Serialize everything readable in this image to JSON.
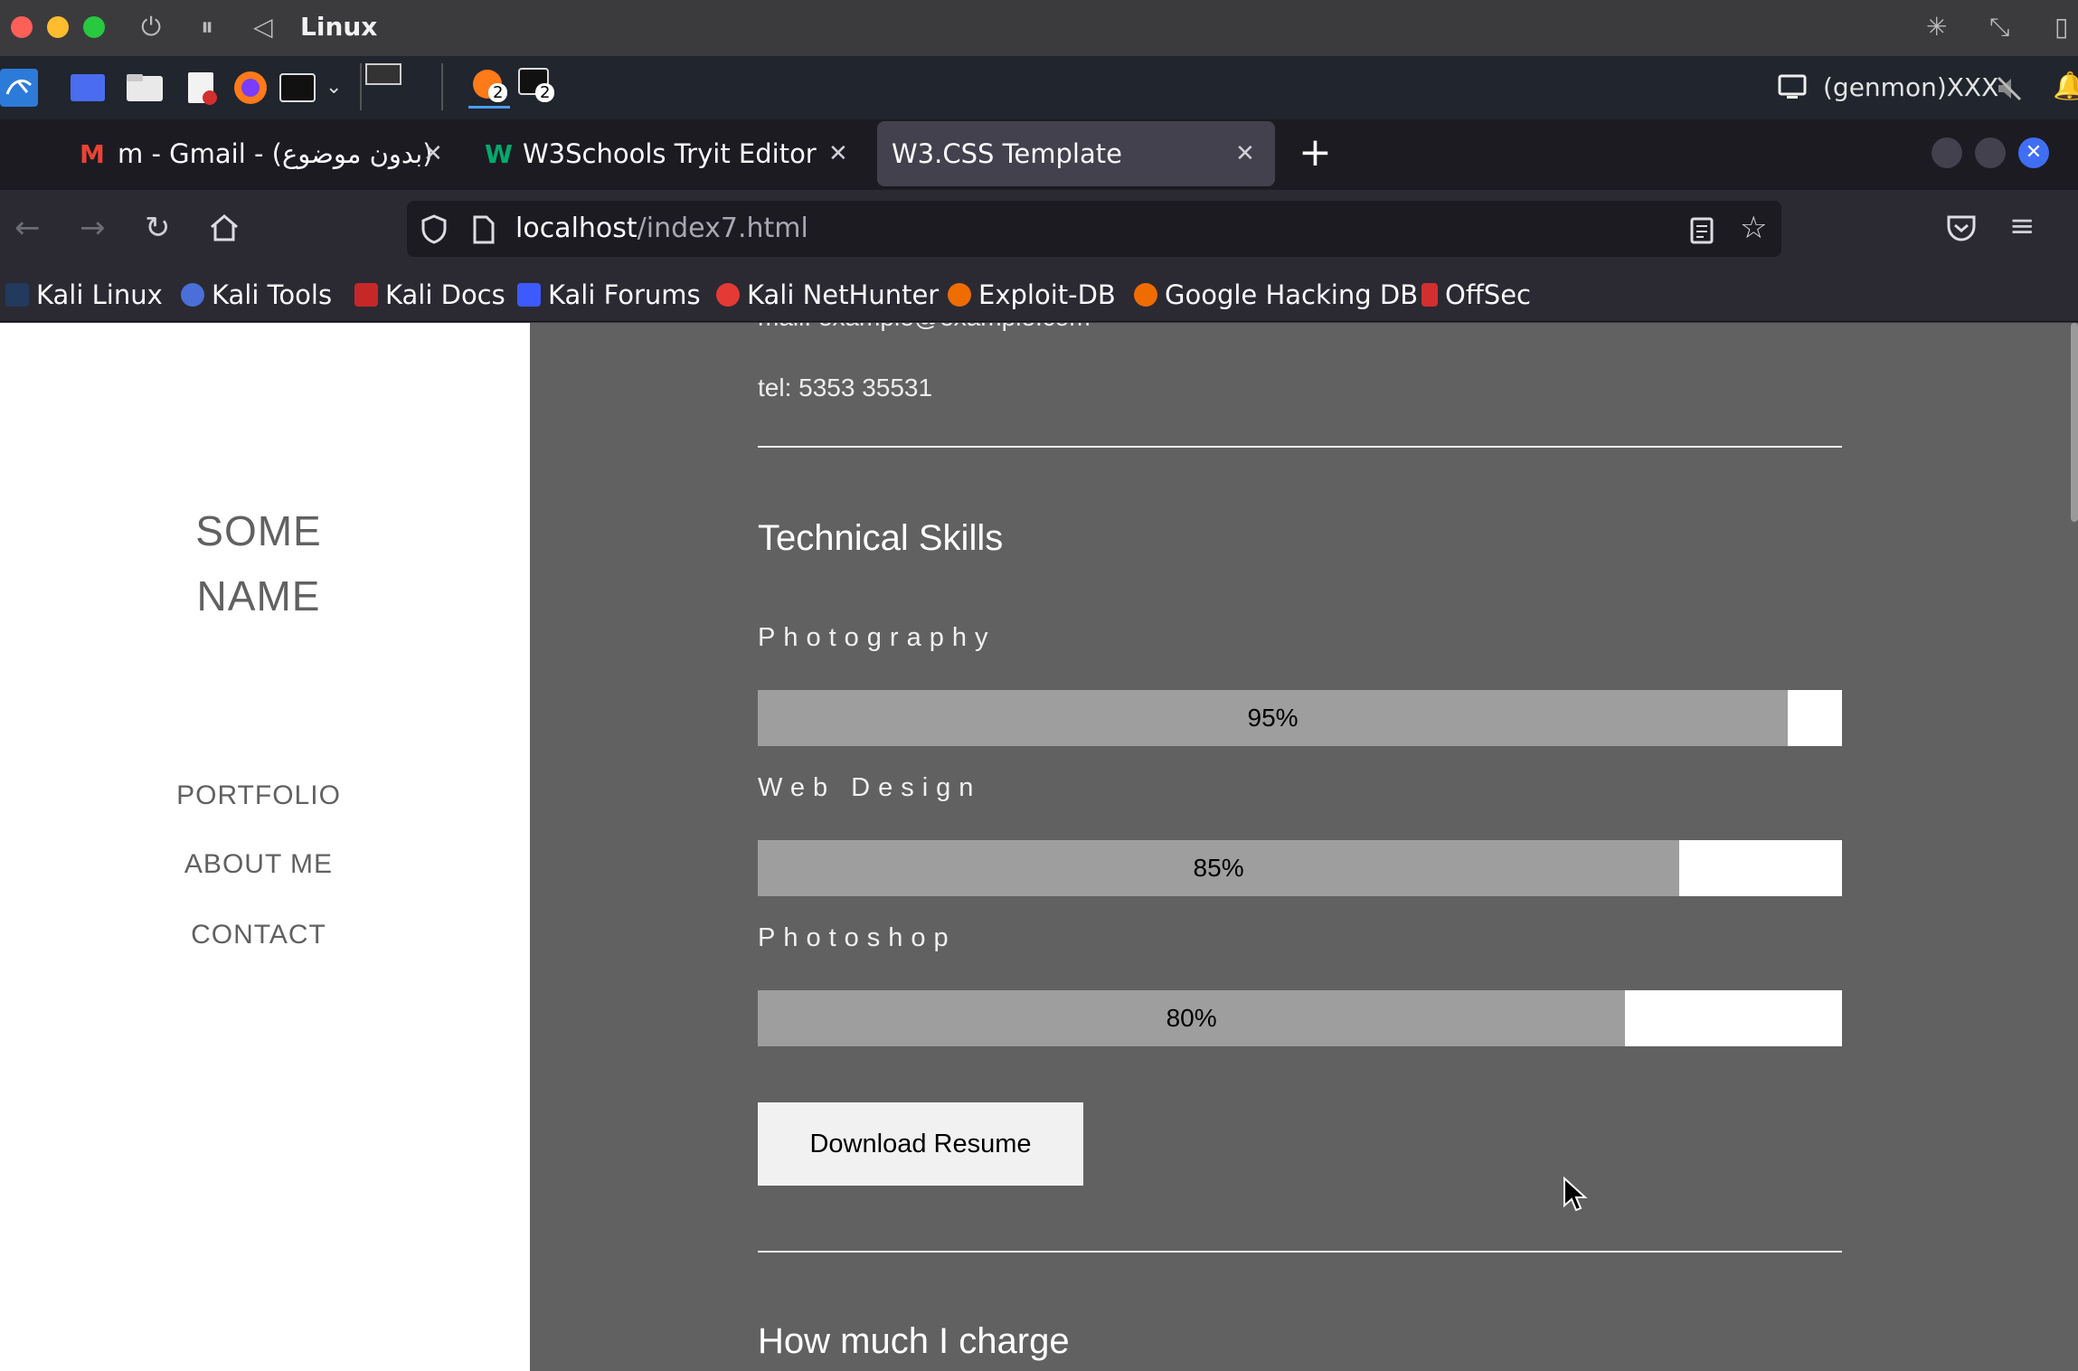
{
  "host": {
    "title": "Linux"
  },
  "panel": {
    "genmon_text": "(genmon)XXX",
    "workspace_badges": [
      "2",
      "2"
    ]
  },
  "browser": {
    "tabs": [
      {
        "label": "m - Gmail - (بدون موضوع)",
        "icon": "gmail-icon"
      },
      {
        "label": "W3Schools Tryit Editor",
        "icon": "w3schools-icon"
      },
      {
        "label": "W3.CSS Template",
        "icon": "none"
      }
    ],
    "url_host": "localhost",
    "url_path": "/index7.html",
    "bookmarks": [
      "Kali Linux",
      "Kali Tools",
      "Kali Docs",
      "Kali Forums",
      "Kali NetHunter",
      "Exploit-DB",
      "Google Hacking DB",
      "OffSec"
    ]
  },
  "page": {
    "sidebar": {
      "name_line1": "SOME",
      "name_line2": "NAME",
      "links": [
        "PORTFOLIO",
        "ABOUT ME",
        "CONTACT"
      ]
    },
    "contact": {
      "mail": "mail: example@example.com",
      "tel": "tel: 5353 35531"
    },
    "technical_skills_title": "Technical Skills",
    "skills": [
      {
        "name": "Photography",
        "percent": 95,
        "label": "95%"
      },
      {
        "name": "Web Design",
        "percent": 85,
        "label": "85%"
      },
      {
        "name": "Photoshop",
        "percent": 80,
        "label": "80%"
      }
    ],
    "download_button": "Download Resume",
    "pricing_title": "How much I charge"
  },
  "colors": {
    "page_bg": "#616161",
    "sidebar_bg": "#ffffff",
    "bar_fill": "#9e9e9e",
    "bar_track": "#ffffff",
    "browser_chrome": "#2b2a33"
  }
}
